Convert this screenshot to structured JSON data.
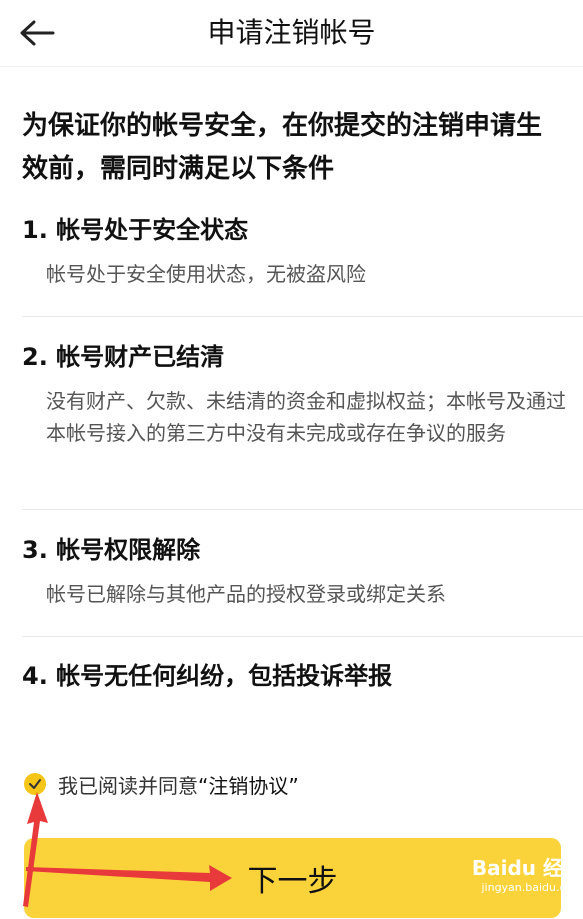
{
  "header": {
    "title": "申请注销帐号",
    "back_icon": "arrow-left-icon"
  },
  "intro": "为保证你的帐号安全，在你提交的注销申请生效前，需同时满足以下条件",
  "conditions": [
    {
      "title": "1. 帐号处于安全状态",
      "desc": "帐号处于安全使用状态，无被盗风险"
    },
    {
      "title": "2. 帐号财产已结清",
      "desc": "没有财产、欠款、未结清的资金和虚拟权益；本帐号及通过本帐号接入的第三方中没有未完成或存在争议的服务"
    },
    {
      "title": "3. 帐号权限解除",
      "desc": "帐号已解除与其他产品的授权登录或绑定关系"
    },
    {
      "title": "4. 帐号无任何纠纷，包括投诉举报",
      "desc": ""
    }
  ],
  "agreement": {
    "text": "我已阅读并同意",
    "link": "“注销协议”",
    "checked": true
  },
  "next_button": {
    "label": "下一步"
  },
  "watermark": {
    "brand": "Baidu 经验",
    "url": "jingyan.baidu.com"
  },
  "colors": {
    "accent": "#fad33b",
    "arrow": "#e8393b"
  }
}
